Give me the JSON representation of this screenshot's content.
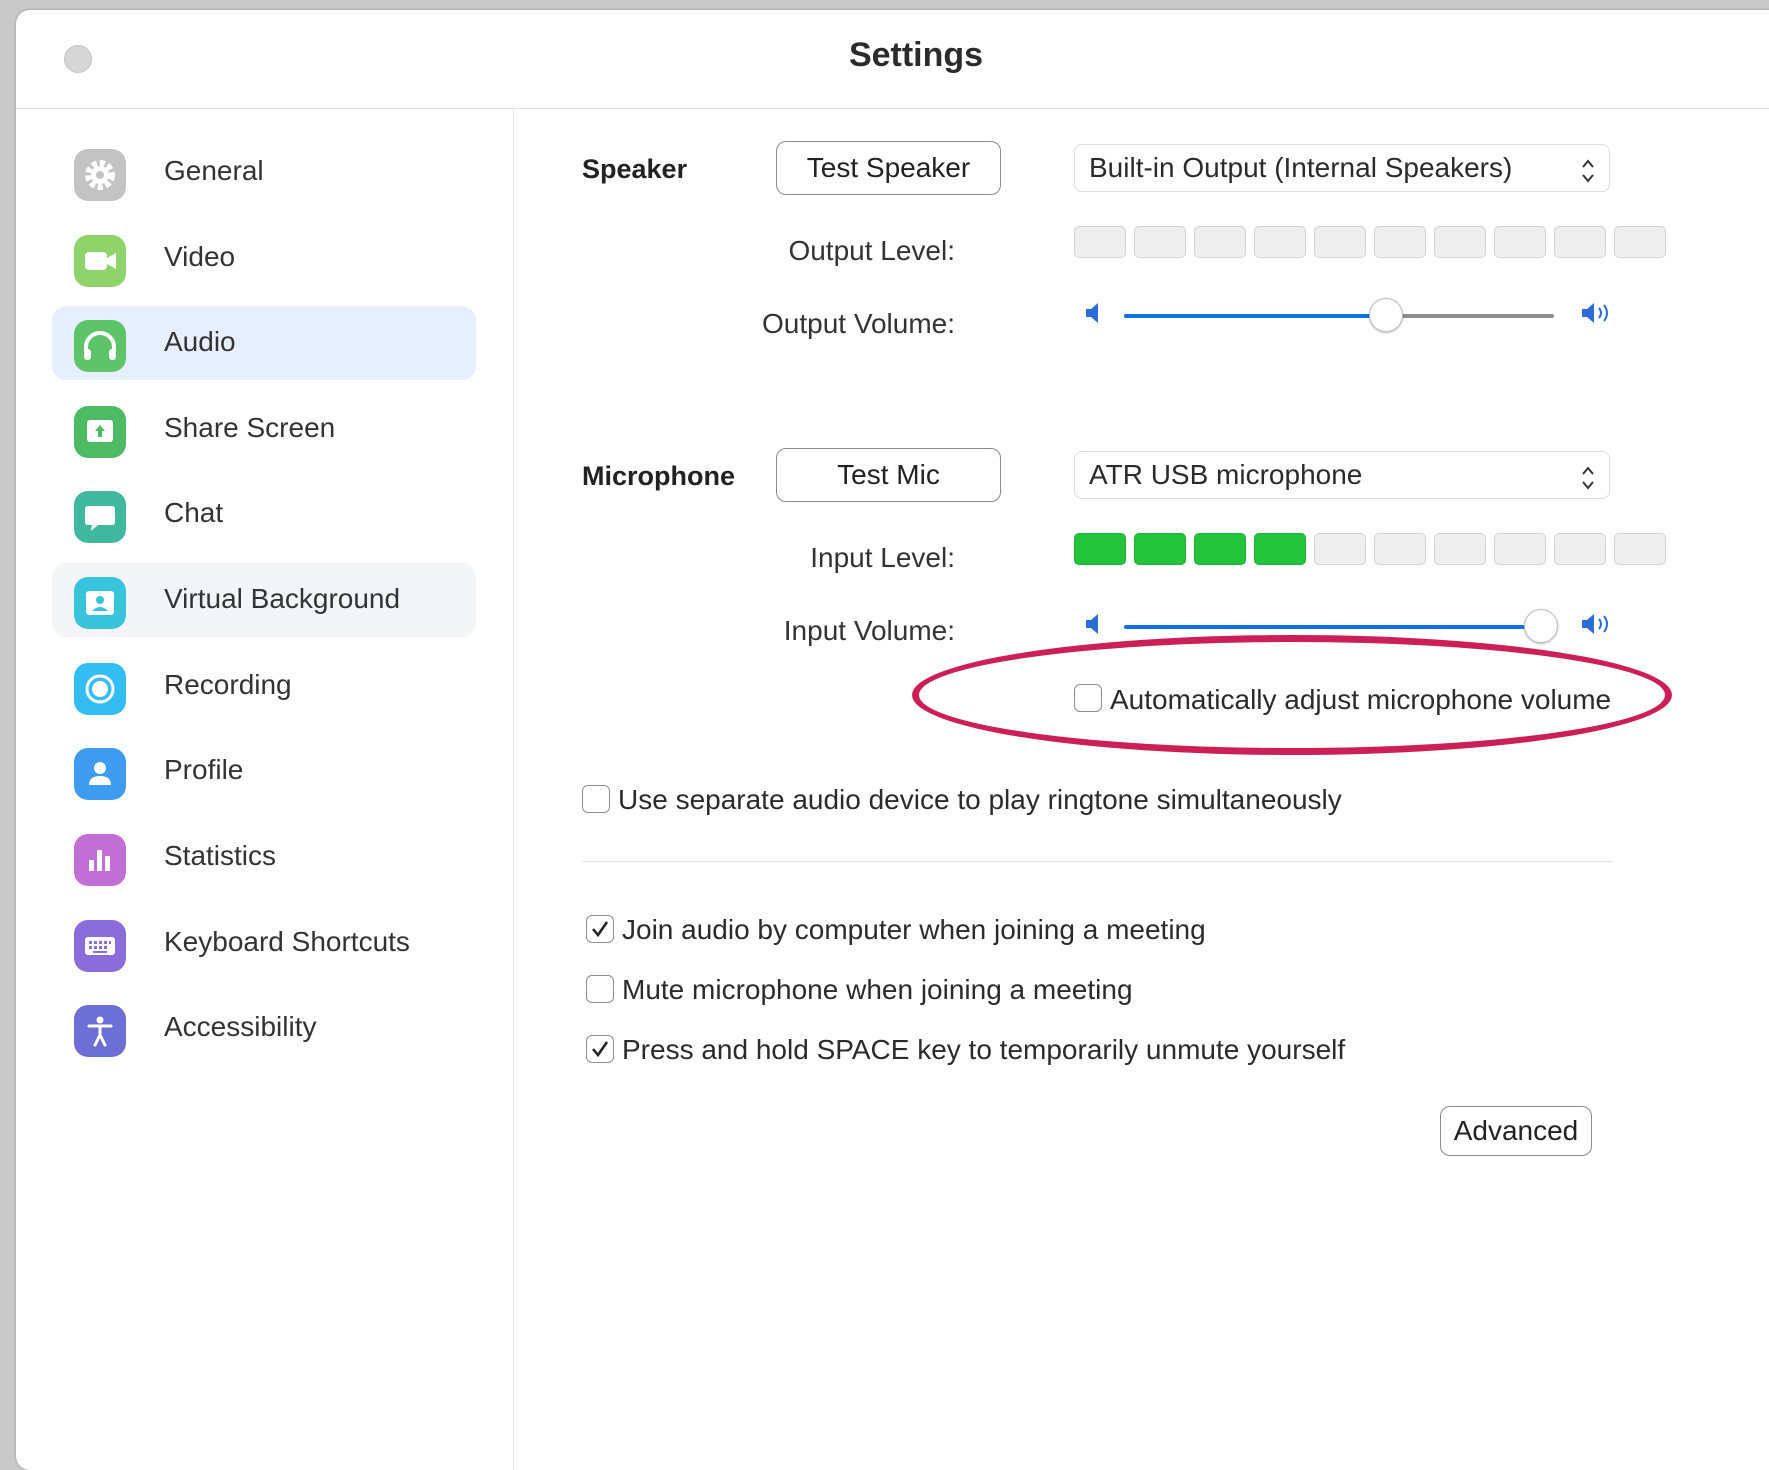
{
  "window": {
    "title": "Settings"
  },
  "sidebar": {
    "items": [
      {
        "label": "General",
        "icon": "gear-icon",
        "color": "#b8b8b8"
      },
      {
        "label": "Video",
        "icon": "video-camera-icon",
        "color": "#8fd36b"
      },
      {
        "label": "Audio",
        "icon": "headphones-icon",
        "color": "#5ec46a"
      },
      {
        "label": "Share Screen",
        "icon": "share-screen-icon",
        "color": "#4cbb63"
      },
      {
        "label": "Chat",
        "icon": "chat-bubble-icon",
        "color": "#3fb89d"
      },
      {
        "label": "Virtual Background",
        "icon": "virtual-background-icon",
        "color": "#38c5dc"
      },
      {
        "label": "Recording",
        "icon": "record-icon",
        "color": "#33bdf2"
      },
      {
        "label": "Profile",
        "icon": "person-icon",
        "color": "#3d9cf0"
      },
      {
        "label": "Statistics",
        "icon": "bar-chart-icon",
        "color": "#c16fd6"
      },
      {
        "label": "Keyboard Shortcuts",
        "icon": "keyboard-icon",
        "color": "#8a6ddb"
      },
      {
        "label": "Accessibility",
        "icon": "accessibility-icon",
        "color": "#6d6fd4"
      }
    ],
    "active": "Audio",
    "hovered": "Virtual Background"
  },
  "speaker": {
    "section_label": "Speaker",
    "test_button": "Test Speaker",
    "device": "Built-in Output (Internal Speakers)",
    "output_level_label": "Output Level:",
    "output_level_segments_lit": 0,
    "output_volume_label": "Output Volume:",
    "output_volume": 0.61
  },
  "microphone": {
    "section_label": "Microphone",
    "test_button": "Test Mic",
    "device": "ATR USB microphone",
    "input_level_label": "Input Level:",
    "input_level_segments_lit": 4,
    "input_volume_label": "Input Volume:",
    "input_volume": 0.97,
    "auto_adjust_label": "Automatically adjust microphone volume",
    "auto_adjust_checked": false
  },
  "options": {
    "separate_ringtone": {
      "label": "Use separate audio device to play ringtone simultaneously",
      "checked": false
    },
    "join_audio": {
      "label": "Join audio by computer when joining a meeting",
      "checked": true
    },
    "mute_on_join": {
      "label": "Mute microphone when joining a meeting",
      "checked": false
    },
    "space_unmute": {
      "label": "Press and hold SPACE key to temporarily unmute yourself",
      "checked": true
    }
  },
  "advanced_button": "Advanced",
  "level_segment_count": 10,
  "colors": {
    "accent": "#0e71eb",
    "level_on": "#23c43c",
    "annotation": "#cc1f55"
  }
}
